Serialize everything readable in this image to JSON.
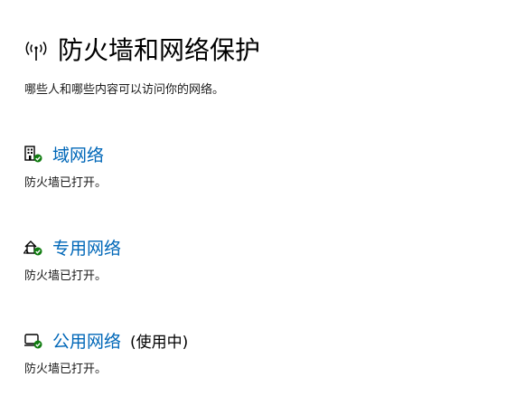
{
  "header": {
    "icon": "wifi-antenna-icon",
    "title": "防火墙和网络保护",
    "subtitle": "哪些人和哪些内容可以访问你的网络。"
  },
  "networks": [
    {
      "icon": "domain-network-icon",
      "name": "域网络",
      "active": "",
      "status": "防火墙已打开。"
    },
    {
      "icon": "private-network-icon",
      "name": "专用网络",
      "active": "",
      "status": "防火墙已打开。"
    },
    {
      "icon": "public-network-icon",
      "name": "公用网络",
      "active": "(使用中)",
      "status": "防火墙已打开。"
    }
  ],
  "colors": {
    "link": "#0067b8",
    "check": "#107c10",
    "text": "#000000"
  }
}
